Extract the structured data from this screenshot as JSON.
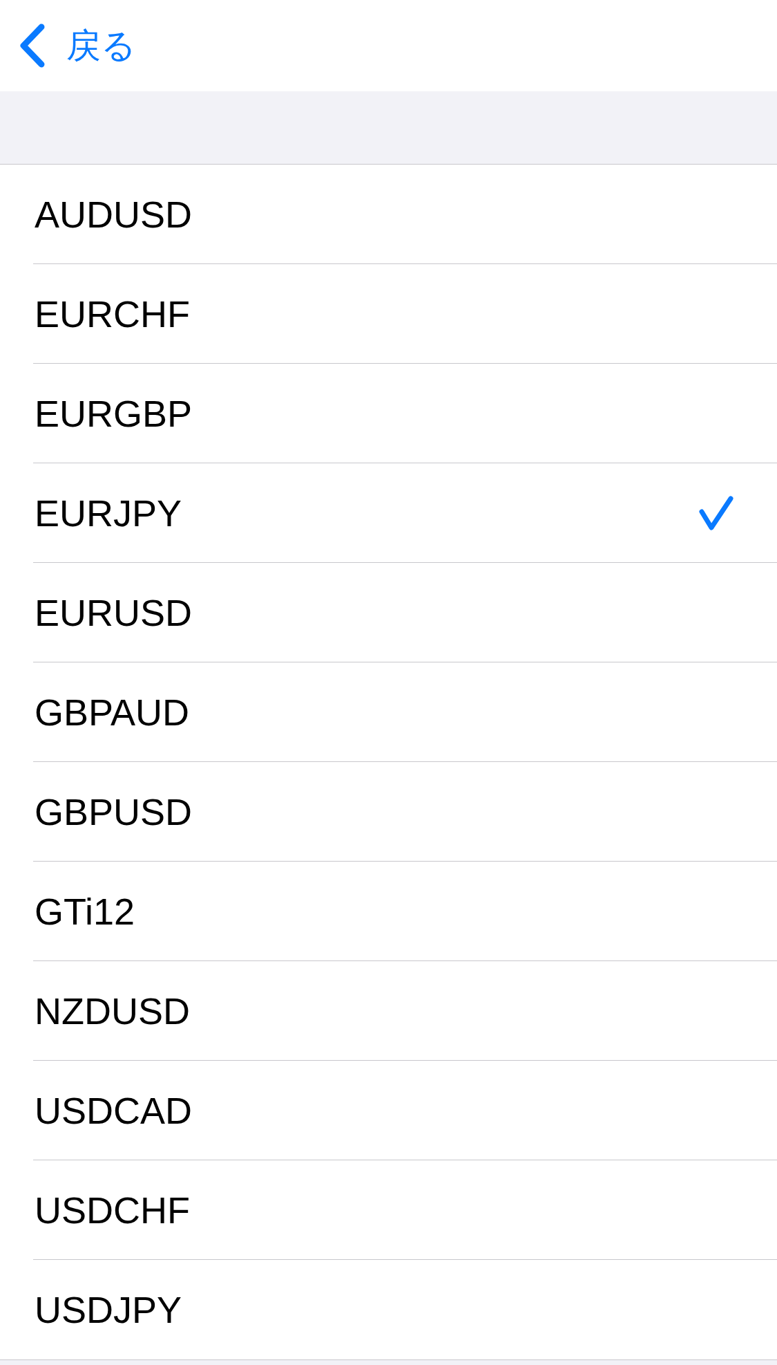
{
  "nav": {
    "back_label": "戻る"
  },
  "items": [
    {
      "label": "AUDUSD",
      "selected": false
    },
    {
      "label": "EURCHF",
      "selected": false
    },
    {
      "label": "EURGBP",
      "selected": false
    },
    {
      "label": "EURJPY",
      "selected": true
    },
    {
      "label": "EURUSD",
      "selected": false
    },
    {
      "label": "GBPAUD",
      "selected": false
    },
    {
      "label": "GBPUSD",
      "selected": false
    },
    {
      "label": "GTi12",
      "selected": false
    },
    {
      "label": "NZDUSD",
      "selected": false
    },
    {
      "label": "USDCAD",
      "selected": false
    },
    {
      "label": "USDCHF",
      "selected": false
    },
    {
      "label": "USDJPY",
      "selected": false
    }
  ]
}
